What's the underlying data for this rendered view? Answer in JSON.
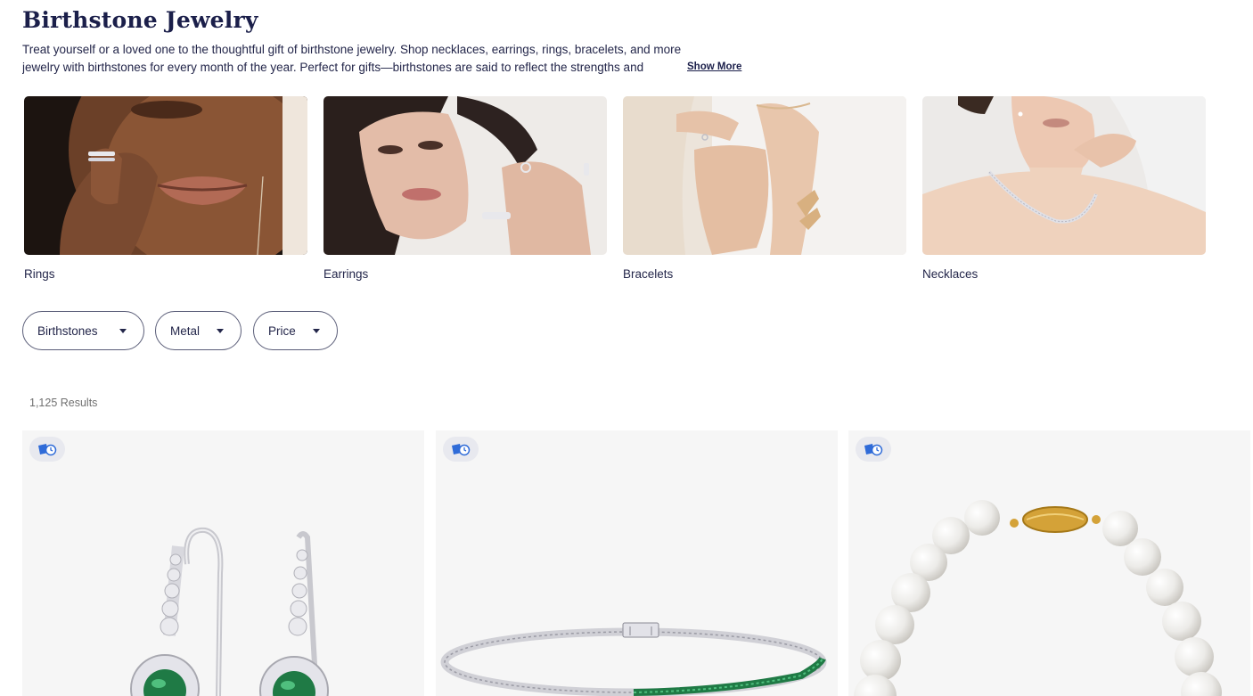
{
  "page": {
    "title": "Birthstone Jewelry",
    "intro_line1": "Treat yourself or a loved one to the thoughtful gift of birthstone jewelry. Shop necklaces, earrings, rings, bracelets, and more",
    "intro_line2": "jewelry with birthstones for every month of the year. Perfect for gifts—birthstones are said to reflect the strengths and",
    "show_more": "Show More"
  },
  "categories": [
    {
      "label": "Rings",
      "icon": "rings-photo"
    },
    {
      "label": "Earrings",
      "icon": "earrings-photo"
    },
    {
      "label": "Bracelets",
      "icon": "bracelets-photo"
    },
    {
      "label": "Necklaces",
      "icon": "necklaces-photo"
    }
  ],
  "filters": [
    {
      "label": "Birthstones"
    },
    {
      "label": "Metal"
    },
    {
      "label": "Price"
    }
  ],
  "results": {
    "text": "1,125 Results"
  },
  "products": [
    {
      "name": "emerald halo drop earrings",
      "badge_icon": "fast-shipping-icon"
    },
    {
      "name": "emerald and diamond tennis bracelet",
      "badge_icon": "fast-shipping-icon"
    },
    {
      "name": "pearl strand bracelet",
      "badge_icon": "fast-shipping-icon"
    }
  ],
  "colors": {
    "navy": "#1b1f4a",
    "badge_blue": "#2f6bd8",
    "card_bg": "#f6f6f6"
  }
}
